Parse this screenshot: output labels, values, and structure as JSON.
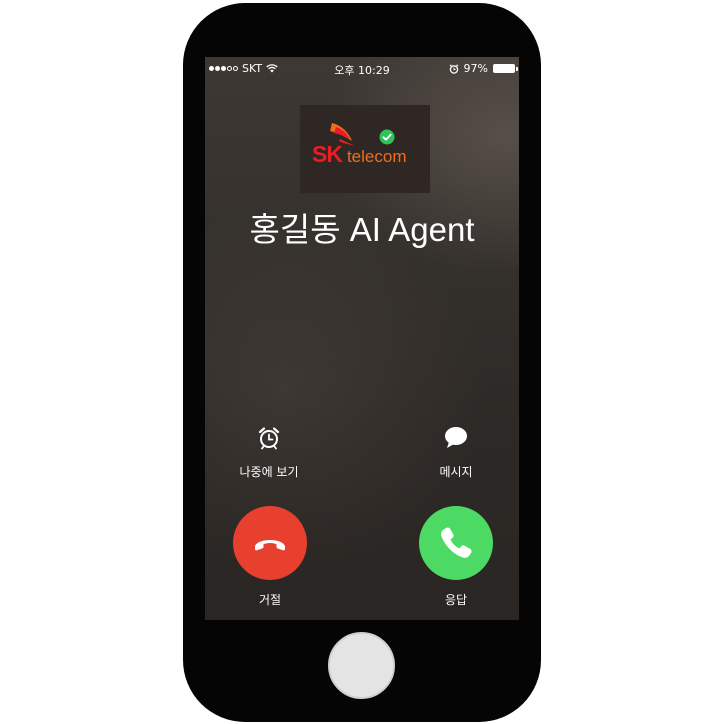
{
  "status_bar": {
    "carrier": "SKT",
    "time": "오후 10:29",
    "battery_percent": "97%"
  },
  "caller": {
    "logo_sk": "SK",
    "logo_telecom": "telecom",
    "name": "홍길동 AI Agent"
  },
  "actions": {
    "remind_label": "나중에 보기",
    "message_label": "메시지"
  },
  "call_buttons": {
    "decline_label": "거절",
    "accept_label": "응답"
  },
  "colors": {
    "decline": "#e7402f",
    "accept": "#4cd964",
    "sk_red": "#ea1c24",
    "sk_orange": "#ef6e1e"
  }
}
